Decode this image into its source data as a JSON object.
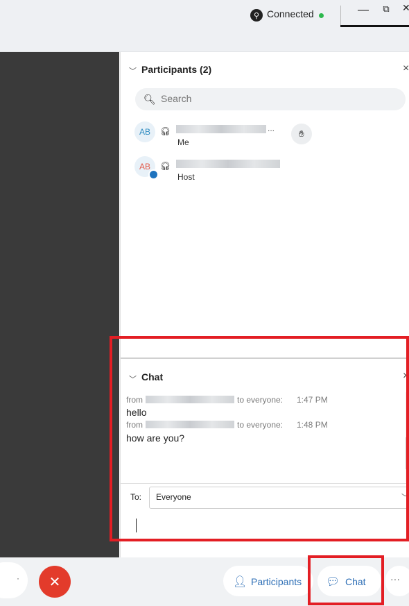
{
  "titlebar": {
    "status_label": "Connected",
    "status_color": "#2db84d",
    "minimize_glyph": "—",
    "restore_glyph": "⧉",
    "close_glyph": "✕"
  },
  "participants": {
    "title": "Participants (2)",
    "close_glyph": "×",
    "search_placeholder": "Search",
    "items": [
      {
        "initials": "AB",
        "name_hidden": true,
        "name_suffix": "...",
        "role": "Me",
        "has_raise_hand": true
      },
      {
        "initials": "AB",
        "name_hidden": true,
        "role": "Host",
        "has_host_badge": true
      }
    ]
  },
  "chat": {
    "title": "Chat",
    "close_glyph": "×",
    "messages": [
      {
        "prefix": "from",
        "to_text": "to everyone:",
        "time": "1:47 PM",
        "text": "hello"
      },
      {
        "prefix": "from",
        "to_text": "to everyone:",
        "time": "1:48 PM",
        "text": "how are you?"
      }
    ],
    "to_label": "To:",
    "to_value": "Everyone"
  },
  "bottombar": {
    "participants_label": "Participants",
    "chat_label": "Chat",
    "leave_glyph": "✕",
    "more_glyph": "···"
  },
  "colors": {
    "accent": "#2e6fb6",
    "leave_red": "#e33b2b",
    "highlight_red": "#e31e24",
    "avatar_text": "#2e8bc0"
  }
}
